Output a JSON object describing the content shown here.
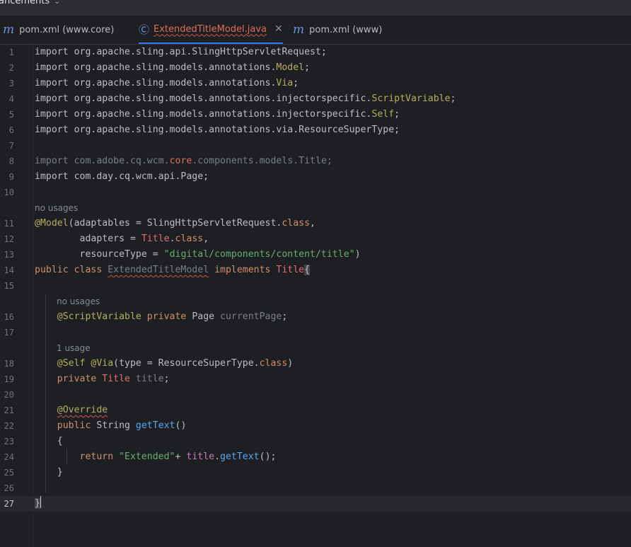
{
  "topbar": {
    "label": "ancements"
  },
  "tabs": [
    {
      "label": "pom.xml (www.core)",
      "icon": "maven-m-icon",
      "active": false
    },
    {
      "label": "ExtendedTitleModel.java",
      "icon": "class-c-icon",
      "active": true
    },
    {
      "label": "pom.xml (www)",
      "icon": "maven-m-icon",
      "active": false
    }
  ],
  "hints": {
    "h11": "no usages",
    "h16": "no usages",
    "h18": "1 usage"
  },
  "lines": {
    "l1": {
      "num": "1",
      "t1": "import org.apache.sling.api.SlingHttpServletRequest;"
    },
    "l2": {
      "num": "2",
      "t1": "import org.apache.sling.models.annotations.",
      "t2": "Model",
      "t3": ";"
    },
    "l3": {
      "num": "3",
      "t1": "import org.apache.sling.models.annotations.",
      "t2": "Via",
      "t3": ";"
    },
    "l4": {
      "num": "4",
      "t1": "import org.apache.sling.models.annotations.injectorspecific.",
      "t2": "ScriptVariable",
      "t3": ";"
    },
    "l5": {
      "num": "5",
      "t1": "import org.apache.sling.models.annotations.injectorspecific.",
      "t2": "Self",
      "t3": ";"
    },
    "l6": {
      "num": "6",
      "t1": "import org.apache.sling.models.annotations.via.ResourceSuperType;"
    },
    "l7": {
      "num": "7"
    },
    "l8": {
      "num": "8",
      "t1": "import com.adobe.cq.wcm.",
      "t2": "core",
      "t3": ".components.models.Title;"
    },
    "l9": {
      "num": "9",
      "t1": "import com.day.cq.wcm.api.Page;"
    },
    "l10": {
      "num": "10"
    },
    "l11": {
      "num": "11",
      "t1": "@Model",
      "t2": "(adaptables = SlingHttpServletRequest.",
      "t3": "class",
      "t4": ","
    },
    "l12": {
      "num": "12",
      "t1": "        adapters = ",
      "t2": "Title",
      "t3": ".",
      "t4": "class",
      "t5": ","
    },
    "l13": {
      "num": "13",
      "t1": "        resourceType = ",
      "t2": "\"digital/components/content/title\"",
      "t3": ")"
    },
    "l14": {
      "num": "14",
      "t1": "public class ",
      "t2": "ExtendedTitleModel",
      "t3": " implements ",
      "t4": "Title",
      "t5": "{"
    },
    "l15": {
      "num": "15"
    },
    "l16": {
      "num": "16",
      "t1": "    @ScriptVariable ",
      "t2": "private ",
      "t3": "Page ",
      "t4": "currentPage",
      "t5": ";"
    },
    "l17": {
      "num": "17"
    },
    "l18": {
      "num": "18",
      "t1": "    @Self @Via",
      "t2": "(type = ResourceSuperType.",
      "t3": "class",
      "t4": ")"
    },
    "l19": {
      "num": "19",
      "t1": "    private ",
      "t2": "Title ",
      "t3": "title",
      "t4": ";"
    },
    "l20": {
      "num": "20"
    },
    "l21": {
      "num": "21",
      "t1": "    ",
      "t2": "@Override"
    },
    "l22": {
      "num": "22",
      "t1": "    public ",
      "t2": "String ",
      "t3": "getText",
      "t4": "()"
    },
    "l23": {
      "num": "23",
      "t1": "    {"
    },
    "l24": {
      "num": "24",
      "t1": "        return ",
      "t2": "\"Extended\"",
      "t3": "+ ",
      "t4": "title",
      "t5": ".",
      "t6": "getText",
      "t7": "();"
    },
    "l25": {
      "num": "25",
      "t1": "    }"
    },
    "l26": {
      "num": "26"
    },
    "l27": {
      "num": "27",
      "t1": "}"
    }
  }
}
